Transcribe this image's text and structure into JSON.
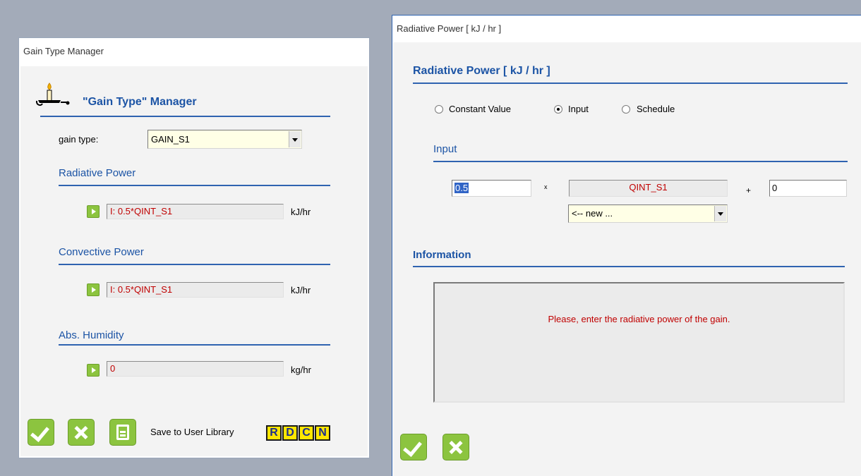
{
  "left_window": {
    "title": "Gain Type Manager",
    "heading": "\"Gain Type\" Manager",
    "heading_icon": "candle-icon",
    "gain_type_label": "gain type:",
    "gain_type_value": "GAIN_S1",
    "sections": [
      {
        "label": "Radiative Power",
        "value": "I: 0.5*QINT_S1",
        "unit": "kJ/hr"
      },
      {
        "label": "Convective Power",
        "value": "I: 0.5*QINT_S1",
        "unit": "kJ/hr"
      },
      {
        "label": "Abs. Humidity",
        "value": "0",
        "unit": "kg/hr"
      }
    ],
    "save_label": "Save to User Library",
    "letter_buttons": [
      "R",
      "D",
      "C",
      "N"
    ]
  },
  "right_window": {
    "title": "Radiative Power  [ kJ / hr ]",
    "heading": "Radiative Power  [ kJ / hr ]",
    "radio_options": [
      {
        "label": "Constant Value",
        "selected": false
      },
      {
        "label": "Input",
        "selected": true
      },
      {
        "label": "Schedule",
        "selected": false
      }
    ],
    "input_section": "Input",
    "factor_value": "0.5",
    "multiply_sign": "x",
    "input_name": "QINT_S1",
    "plus_sign": "+",
    "offset_value": "0",
    "input_select_value": "<-- new ...",
    "information_section": "Information",
    "information_text": "Please, enter the radiative power of the gain."
  },
  "colors": {
    "accent_blue": "#1c54a5",
    "button_green": "#8cc43f",
    "value_red": "#c00000",
    "letter_yellow": "#ffe600"
  }
}
